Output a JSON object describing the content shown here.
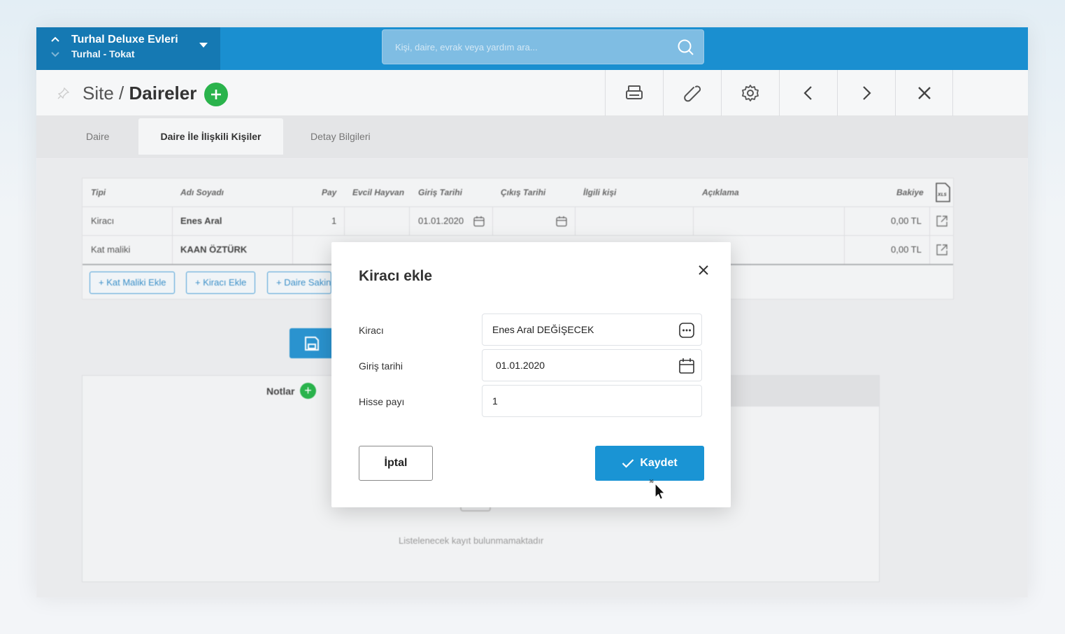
{
  "site": {
    "name": "Turhal Deluxe Evleri",
    "location": "Turhal - Tokat"
  },
  "search": {
    "placeholder": "Kişi, daire, evrak veya yardım ara..."
  },
  "header": {
    "title_prefix": "Site / ",
    "title_main": "Daireler"
  },
  "tabs": [
    {
      "label": "Daire"
    },
    {
      "label": "Daire İle İlişkili Kişiler",
      "active": true
    },
    {
      "label": "Detay Bilgileri"
    }
  ],
  "grid": {
    "columns": [
      "Tipi",
      "Adı Soyadı",
      "Pay",
      "Evcil Hayvan",
      "Giriş Tarihi",
      "Çıkış Tarihi",
      "İlgili kişi",
      "Açıklama",
      "Bakiye"
    ],
    "rows": [
      {
        "tipi": "Kiracı",
        "ad": "Enes Aral",
        "pay": "1",
        "giris": "01.01.2020",
        "bakiye": "0,00 TL"
      },
      {
        "tipi": "Kat maliki",
        "ad": "KAAN ÖZTÜRK",
        "pay": "",
        "giris": "",
        "bakiye": "0,00 TL"
      }
    ],
    "actions": [
      "+ Kat Maliki Ekle",
      "+ Kiracı Ekle",
      "+ Daire Sakini Ekle"
    ]
  },
  "save_button_label": "Kaydet",
  "notes": {
    "title": "Notlar",
    "empty_text": "Listelenecek kayıt bulunmamaktadır"
  },
  "modal": {
    "title": "Kiracı ekle",
    "fields": [
      {
        "label": "Kiracı",
        "value": "Enes Aral DEĞİŞECEK"
      },
      {
        "label": "Giriş tarihi",
        "value": "01.01.2020"
      },
      {
        "label": "Hisse payı",
        "value": "1"
      }
    ],
    "cancel_label": "İptal",
    "save_label": "Kaydet"
  },
  "colors": {
    "primary": "#1a94d4",
    "topbar": "#1a8fd0",
    "success": "#2ab34c"
  }
}
